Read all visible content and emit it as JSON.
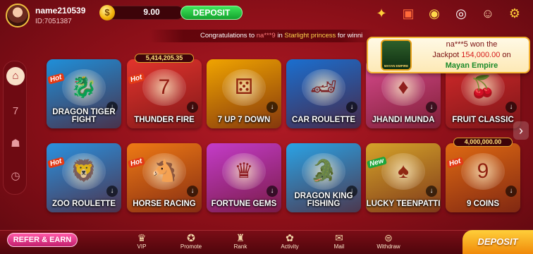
{
  "user": {
    "name": "name210539",
    "id": "ID:7051387",
    "balance": "9.00"
  },
  "header": {
    "deposit_label": "DEPOSIT",
    "icons": [
      "gift-box-icon",
      "gift-icon",
      "spin-wheel-icon",
      "target-icon",
      "support-agent-icon",
      "gear-icon"
    ]
  },
  "marquee": {
    "prefix": "Congratulations to ",
    "user": "na***9",
    "mid": " in ",
    "game": "Starlight princess",
    "suffix": " for winni"
  },
  "jackpot": {
    "user_line": "na***5 won the",
    "jackpot_word": "Jackpot ",
    "amount": "154,000.00",
    "on_word": " on",
    "game": "Mayan Empire",
    "thumb_text": "MAYAN EMPIRE"
  },
  "rail": {
    "items": [
      "home-icon",
      "slots-777-icon",
      "people-icon",
      "history-icon"
    ]
  },
  "games": [
    {
      "label": "DRAGON TIGER FIGHT",
      "hot": "Hot",
      "color": "#1f8fd9"
    },
    {
      "label": "THUNDER FIRE",
      "hot": "Hot",
      "color": "#e3342c",
      "badge": "5,414,205.35"
    },
    {
      "label": "7 UP 7 DOWN",
      "color": "#f0a400"
    },
    {
      "label": "CAR ROULETTE",
      "color": "#1a6fd0"
    },
    {
      "label": "JHANDI MUNDA",
      "color": "#d84a8e"
    },
    {
      "label": "FRUIT CLASSIC",
      "color": "#d42a2a"
    },
    {
      "label": "ZOO ROULETTE",
      "hot": "Hot",
      "color": "#2a92e0"
    },
    {
      "label": "HORSE RACING",
      "hot": "Hot",
      "color": "#ef7a14"
    },
    {
      "label": "FORTUNE GEMS",
      "color": "#c43cc9"
    },
    {
      "label": "DRAGON KING FISHING",
      "color": "#2aa3e6"
    },
    {
      "label": "LUCKY TEENPATTI",
      "hot": "New",
      "color": "#d6a42a"
    },
    {
      "label": "9 COINS",
      "hot": "Hot",
      "color": "#e06a12",
      "badge": "4,000,000.00"
    }
  ],
  "bottom": {
    "refer_label": "REFER & EARN",
    "nav": [
      {
        "label": "VIP",
        "icon": "vip-crown-icon"
      },
      {
        "label": "Promote",
        "icon": "promote-icon"
      },
      {
        "label": "Rank",
        "icon": "trophy-icon"
      },
      {
        "label": "Activity",
        "icon": "activity-gift-icon"
      },
      {
        "label": "Mail",
        "icon": "mail-icon"
      },
      {
        "label": "Withdraw",
        "icon": "withdraw-icon"
      }
    ],
    "deposit_label": "DEPOSIT"
  }
}
